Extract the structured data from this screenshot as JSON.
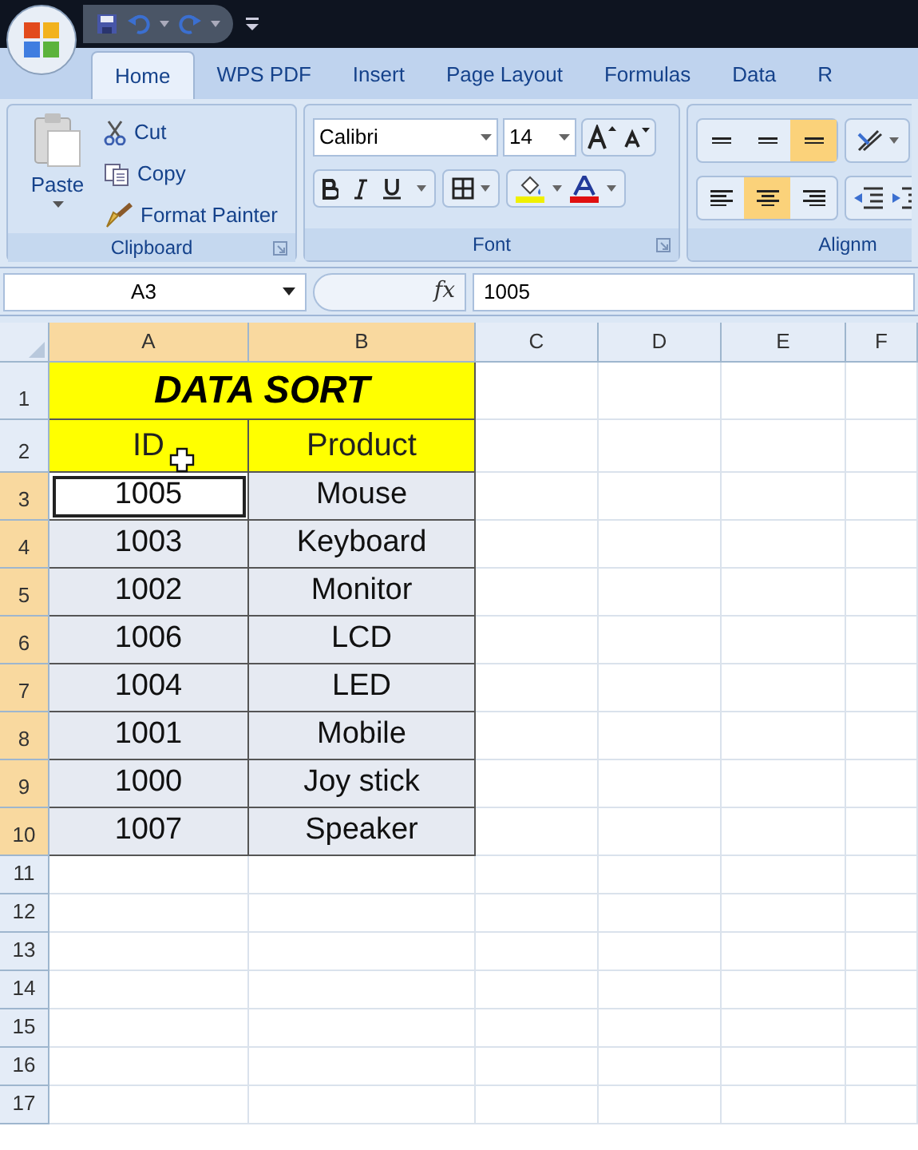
{
  "tabs": [
    {
      "label": "Home",
      "selected": true
    },
    {
      "label": "WPS PDF",
      "selected": false
    },
    {
      "label": "Insert",
      "selected": false
    },
    {
      "label": "Page Layout",
      "selected": false
    },
    {
      "label": "Formulas",
      "selected": false
    },
    {
      "label": "Data",
      "selected": false
    },
    {
      "label": "R",
      "selected": false
    }
  ],
  "ribbon": {
    "clipboard": {
      "label": "Clipboard",
      "paste": "Paste",
      "items": [
        {
          "kind": "cut",
          "label": "Cut"
        },
        {
          "kind": "copy",
          "label": "Copy"
        },
        {
          "kind": "painter",
          "label": "Format Painter"
        }
      ]
    },
    "font": {
      "label": "Font",
      "font_name": "Calibri",
      "font_size": "14"
    },
    "alignment": {
      "label": "Alignm",
      "buttons": [
        {
          "kind": "top",
          "selected": false
        },
        {
          "kind": "middle",
          "selected": false
        },
        {
          "kind": "bottom",
          "selected": true
        },
        {
          "kind": "left",
          "selected": false
        },
        {
          "kind": "center",
          "selected": true
        },
        {
          "kind": "right",
          "selected": false
        }
      ]
    }
  },
  "formula_bar": {
    "name_box": "A3",
    "function_button": "fx",
    "value": "1005"
  },
  "sheet": {
    "columns": [
      {
        "label": "A",
        "selected": true
      },
      {
        "label": "B",
        "selected": true
      },
      {
        "label": "C",
        "selected": false
      },
      {
        "label": "D",
        "selected": false
      },
      {
        "label": "E",
        "selected": false
      },
      {
        "label": "F",
        "selected": false
      }
    ],
    "rows": [
      {
        "number": "1",
        "selected": false,
        "cells": [
          {
            "kind": "title",
            "text": "DATA SORT"
          }
        ]
      },
      {
        "number": "2",
        "selected": false,
        "cells": [
          {
            "kind": "header",
            "text": "ID"
          },
          {
            "kind": "header",
            "text": "Product"
          }
        ]
      },
      {
        "number": "3",
        "selected": true,
        "cells": [
          {
            "kind": "data",
            "text": "1005",
            "selected": true,
            "active": true
          },
          {
            "kind": "data",
            "text": "Mouse",
            "selected": true,
            "active": false
          }
        ]
      },
      {
        "number": "4",
        "selected": true,
        "cells": [
          {
            "kind": "data",
            "text": "1003",
            "selected": true,
            "active": false
          },
          {
            "kind": "data",
            "text": "Keyboard",
            "selected": true,
            "active": false
          }
        ]
      },
      {
        "number": "5",
        "selected": true,
        "cells": [
          {
            "kind": "data",
            "text": "1002",
            "selected": true,
            "active": false
          },
          {
            "kind": "data",
            "text": "Monitor",
            "selected": true,
            "active": false
          }
        ]
      },
      {
        "number": "6",
        "selected": true,
        "cells": [
          {
            "kind": "data",
            "text": "1006",
            "selected": true,
            "active": false
          },
          {
            "kind": "data",
            "text": "LCD",
            "selected": true,
            "active": false
          }
        ]
      },
      {
        "number": "7",
        "selected": true,
        "cells": [
          {
            "kind": "data",
            "text": "1004",
            "selected": true,
            "active": false
          },
          {
            "kind": "data",
            "text": "LED",
            "selected": true,
            "active": false
          }
        ]
      },
      {
        "number": "8",
        "selected": true,
        "cells": [
          {
            "kind": "data",
            "text": "1001",
            "selected": true,
            "active": false
          },
          {
            "kind": "data",
            "text": "Mobile",
            "selected": true,
            "active": false
          }
        ]
      },
      {
        "number": "9",
        "selected": true,
        "cells": [
          {
            "kind": "data",
            "text": "1000",
            "selected": true,
            "active": false
          },
          {
            "kind": "data",
            "text": "Joy stick",
            "selected": true,
            "active": false
          }
        ]
      },
      {
        "number": "10",
        "selected": true,
        "cells": [
          {
            "kind": "data",
            "text": "1007",
            "selected": true,
            "active": false
          },
          {
            "kind": "data",
            "text": "Speaker",
            "selected": true,
            "active": false
          }
        ]
      },
      {
        "number": "11",
        "selected": false,
        "cells": []
      },
      {
        "number": "12",
        "selected": false,
        "cells": []
      },
      {
        "number": "13",
        "selected": false,
        "cells": []
      },
      {
        "number": "14",
        "selected": false,
        "cells": []
      },
      {
        "number": "15",
        "selected": false,
        "cells": []
      },
      {
        "number": "16",
        "selected": false,
        "cells": []
      },
      {
        "number": "17",
        "selected": false,
        "cells": []
      }
    ]
  }
}
